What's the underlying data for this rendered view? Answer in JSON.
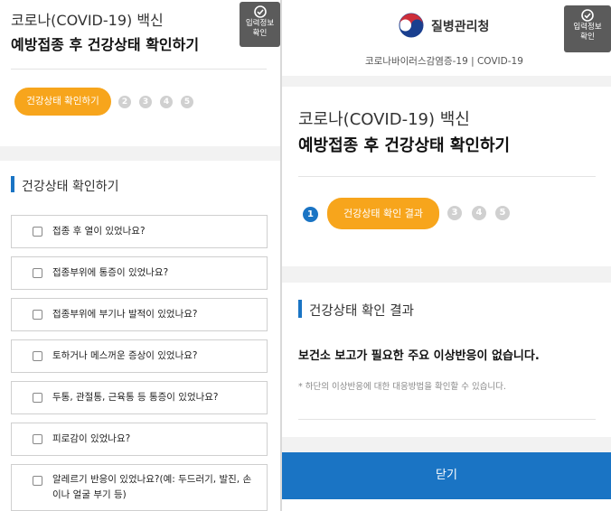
{
  "left": {
    "input_info": {
      "line1": "입력정보",
      "line2": "확인"
    },
    "title_line1": "코로나(COVID-19) 백신",
    "title_line2": "예방접종 후 건강상태 확인하기",
    "steps": {
      "active_label": "건강상태 확인하기",
      "others": [
        "2",
        "3",
        "4",
        "5"
      ]
    },
    "section_title": "건강상태 확인하기",
    "questions": [
      "접종 후 열이 있었나요?",
      "접종부위에 통증이 있었나요?",
      "접종부위에 부기나 발적이 있었나요?",
      "토하거나 메스꺼운 증상이 있었나요?",
      "두통, 관절통, 근육통 등 통증이 있었나요?",
      "피로감이 있었나요?",
      "알레르기 반응이 있었나요?(예: 두드러기, 발진, 손이나 얼굴 부기 등)"
    ]
  },
  "right": {
    "input_info": {
      "line1": "입력정보",
      "line2": "확인"
    },
    "logo_text": "질병관리청",
    "subheader": "코로나바이러스감염증-19 | COVID-19",
    "title_line1": "코로나(COVID-19) 백신",
    "title_line2": "예방접종 후 건강상태 확인하기",
    "steps": {
      "done": "1",
      "active_label": "건강상태 확인 결과",
      "others": [
        "3",
        "4",
        "5"
      ]
    },
    "section_title": "건강상태 확인 결과",
    "result_main": "보건소 보고가 필요한 주요 이상반응이 없습니다.",
    "result_note": "* 하단의 이상반응에 대한 대응방법을 확인할 수 있습니다.",
    "close_label": "닫기"
  },
  "colors": {
    "accent_blue": "#1a74c4",
    "step_orange": "#f7a51c",
    "badge_gray": "#5b5b5b"
  }
}
